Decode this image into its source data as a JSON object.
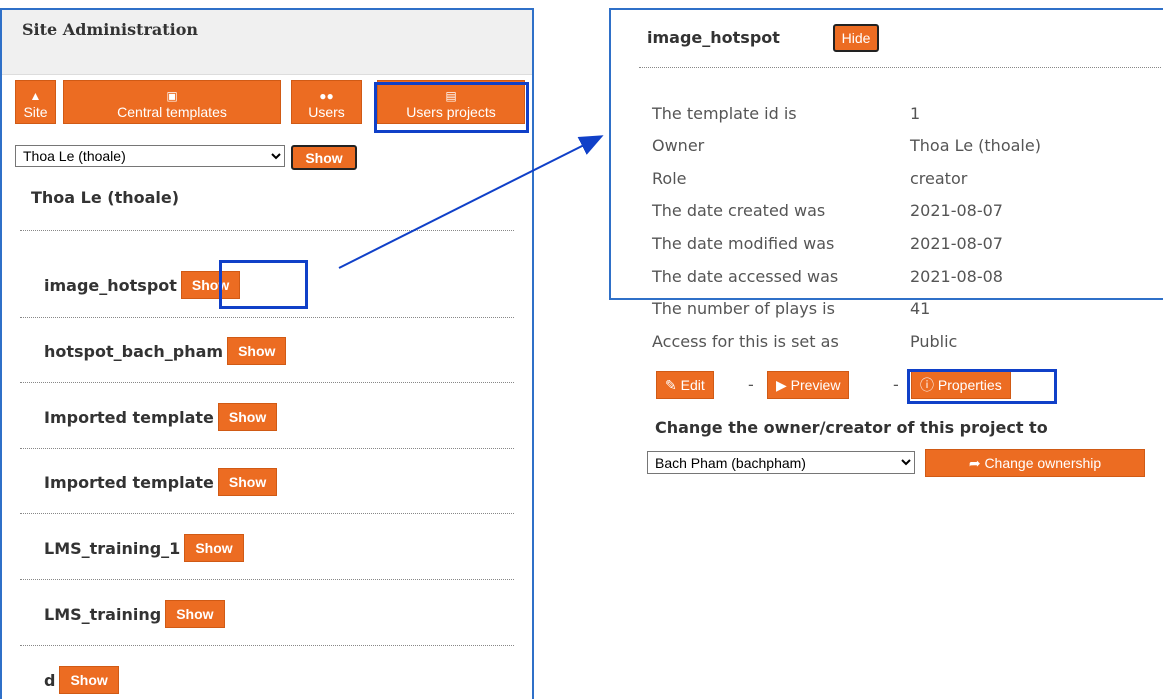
{
  "left": {
    "title": "Site Administration",
    "nav": [
      {
        "label": "Site",
        "icon": "sitemap-icon"
      },
      {
        "label": "Central templates",
        "icon": "template-icon"
      },
      {
        "label": "Users",
        "icon": "users-icon"
      },
      {
        "label": "Users projects",
        "icon": "file-icon"
      }
    ],
    "user_select_value": "Thoa Le (thoale)",
    "show_label": "Show",
    "user_heading": "Thoa Le (thoale)",
    "projects": [
      {
        "name": "image_hotspot",
        "action": "Show"
      },
      {
        "name": "hotspot_bach_pham",
        "action": "Show"
      },
      {
        "name": "Imported template",
        "action": "Show"
      },
      {
        "name": "Imported template",
        "action": "Show"
      },
      {
        "name": "LMS_training_1",
        "action": "Show"
      },
      {
        "name": "LMS_training",
        "action": "Show"
      },
      {
        "name": "d",
        "action": "Show"
      }
    ]
  },
  "right": {
    "title": "image_hotspot",
    "hide_label": "Hide",
    "properties": [
      {
        "label": "The template id is",
        "value": "1"
      },
      {
        "label": "Owner",
        "value": "Thoa Le (thoale)"
      },
      {
        "label": "Role",
        "value": "creator"
      },
      {
        "label": "The date created was",
        "value": "2021-08-07"
      },
      {
        "label": "The date modified was",
        "value": "2021-08-07"
      },
      {
        "label": "The date accessed was",
        "value": "2021-08-08"
      },
      {
        "label": "The number of plays is",
        "value": "41"
      },
      {
        "label": "Access for this is set as",
        "value": "Public"
      }
    ],
    "actions": {
      "edit": "Edit",
      "preview": "Preview",
      "properties": "Properties",
      "separator": "-"
    },
    "change_owner_label": "Change the owner/creator of this project to",
    "owner_select_value": "Bach Pham (bachpham)",
    "change_ownership_label": "Change ownership"
  },
  "colors": {
    "accent": "#ec6c22",
    "highlight": "#1040c8",
    "panel_border": "#2f70c8"
  }
}
